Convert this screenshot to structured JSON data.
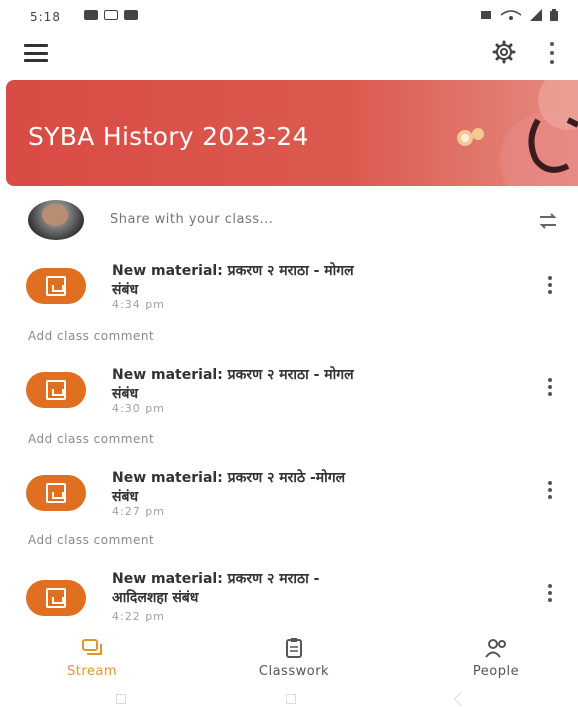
{
  "status_bar": {
    "time": "5:18"
  },
  "header": {
    "menu_icon": "hamburger-menu-icon",
    "settings_icon": "gear-icon",
    "more_icon": "more-vertical-icon"
  },
  "banner": {
    "title": "SYBA History 2023-24",
    "color": "#d94b44"
  },
  "share": {
    "placeholder": "Share with your class..."
  },
  "posts": [
    {
      "line1": "New material: प्रकरण २  मराठा - मोगल",
      "line2": "संबंध",
      "time": "4:34 pm",
      "comment": "Add class comment"
    },
    {
      "line1": "New material: प्रकरण २ मराठा - मोगल",
      "line2": "संबंध",
      "time": "4:30 pm",
      "comment": "Add class comment"
    },
    {
      "line1": "New material: प्रकरण २ मराठे -मोगल",
      "line2": "संबंध",
      "time": "4:27 pm",
      "comment": "Add class comment"
    },
    {
      "line1": "New material: प्रकरण २ मराठा -",
      "line2": "आदिलशहा संबंध",
      "time": "4:22 pm",
      "comment": ""
    }
  ],
  "bottom_nav": {
    "items": [
      {
        "label": "Stream",
        "icon": "stream-icon",
        "active": true
      },
      {
        "label": "Classwork",
        "icon": "classwork-icon",
        "active": false
      },
      {
        "label": "People",
        "icon": "people-icon",
        "active": false
      }
    ]
  },
  "colors": {
    "accent": "#e0962b",
    "material_icon": "#e06f22",
    "banner": "#d94b44"
  }
}
